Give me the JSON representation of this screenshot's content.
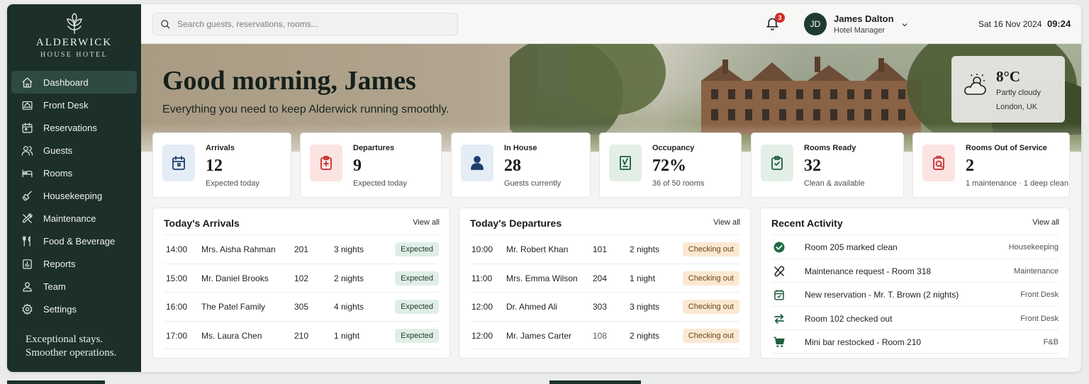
{
  "brand": {
    "name": "ALDERWICK",
    "sub": "HOUSE HOTEL",
    "tagline_1": "Exceptional stays.",
    "tagline_2": "Smoother operations."
  },
  "nav": [
    {
      "label": "Dashboard",
      "icon": "home-icon",
      "active": true
    },
    {
      "label": "Front Desk",
      "icon": "bell-desk-icon"
    },
    {
      "label": "Reservations",
      "icon": "calendar-icon"
    },
    {
      "label": "Guests",
      "icon": "users-icon"
    },
    {
      "label": "Rooms",
      "icon": "bed-icon"
    },
    {
      "label": "Housekeeping",
      "icon": "broom-icon"
    },
    {
      "label": "Maintenance",
      "icon": "tools-icon"
    },
    {
      "label": "Food & Beverage",
      "icon": "cutlery-icon"
    },
    {
      "label": "Reports",
      "icon": "chart-icon"
    },
    {
      "label": "Team",
      "icon": "team-icon"
    },
    {
      "label": "Settings",
      "icon": "gear-icon"
    }
  ],
  "topbar": {
    "search_placeholder": "Search guests, reservations, rooms...",
    "notifications": "3",
    "avatar": "JD",
    "user_name": "James Dalton",
    "user_role": "Hotel Manager",
    "date": "Sat 16 Nov 2024",
    "time": "09:24"
  },
  "hero": {
    "greeting": "Good morning, James",
    "subtitle": "Everything you need to keep Alderwick running smoothly.",
    "weather": {
      "temp": "8°C",
      "condition": "Partly cloudy",
      "location": "London, UK"
    }
  },
  "stats": [
    {
      "title": "Arrivals",
      "value": "12",
      "sub": "Expected today",
      "icon": "calendar-icon",
      "bg": "#e4ecf5",
      "fg": "#1d3f6e"
    },
    {
      "title": "Departures",
      "value": "9",
      "sub": "Expected today",
      "icon": "clipboard-icon",
      "bg": "#fbe3e1",
      "fg": "#c62d2d"
    },
    {
      "title": "In House",
      "value": "28",
      "sub": "Guests currently",
      "icon": "person-icon",
      "bg": "#e4ecf5",
      "fg": "#1d3f6e"
    },
    {
      "title": "Occupancy",
      "value": "72%",
      "sub": "36 of 50 rooms",
      "icon": "door-icon",
      "bg": "#e3eee7",
      "fg": "#1f5e3c"
    },
    {
      "title": "Rooms Ready",
      "value": "32",
      "sub": "Clean & available",
      "icon": "checklist-icon",
      "bg": "#e3eee7",
      "fg": "#1f5e3c"
    },
    {
      "title": "Rooms Out of Service",
      "value": "2",
      "sub": "1 maintenance · 1 deep clean",
      "icon": "warning-icon",
      "bg": "#fbe3e1",
      "fg": "#c62d2d"
    }
  ],
  "arrivals": {
    "title": "Today's Arrivals",
    "view_all": "View all",
    "rows": [
      {
        "time": "14:00",
        "guest": "Mrs. Aisha Rahman",
        "room": "201",
        "nights": "3 nights",
        "status": "Expected"
      },
      {
        "time": "15:00",
        "guest": "Mr. Daniel Brooks",
        "room": "102",
        "nights": "2 nights",
        "status": "Expected"
      },
      {
        "time": "16:00",
        "guest": "The Patel Family",
        "room": "305",
        "nights": "4 nights",
        "status": "Expected"
      },
      {
        "time": "17:00",
        "guest": "Ms. Laura Chen",
        "room": "210",
        "nights": "1 night",
        "status": "Expected"
      }
    ]
  },
  "departures": {
    "title": "Today's Departures",
    "view_all": "View all",
    "rows": [
      {
        "time": "10:00",
        "guest": "Mr. Robert Khan",
        "room": "101",
        "nights": "2 nights",
        "status": "Checking out"
      },
      {
        "time": "11:00",
        "guest": "Mrs. Emma Wilson",
        "room": "204",
        "nights": "1 night",
        "status": "Checking out"
      },
      {
        "time": "12:00",
        "guest": "Dr. Ahmed Ali",
        "room": "303",
        "nights": "3 nights",
        "status": "Checking out"
      },
      {
        "time": "12:00",
        "guest": "Mr. James Carter",
        "room": "108",
        "nights": "2 nights",
        "status": "Checking out"
      }
    ]
  },
  "activity": {
    "title": "Recent Activity",
    "view_all": "View all",
    "rows": [
      {
        "text": "Room 205 marked clean",
        "dept": "Housekeeping",
        "icon": "check-circle-icon",
        "color": "#1f6b45"
      },
      {
        "text": "Maintenance request - Room 318",
        "dept": "Maintenance",
        "icon": "tools-icon",
        "color": "#1f2522"
      },
      {
        "text": "New reservation - Mr. T. Brown (2 nights)",
        "dept": "Front Desk",
        "icon": "calendar-icon",
        "color": "#1f5e3c"
      },
      {
        "text": "Room 102 checked out",
        "dept": "Front Desk",
        "icon": "swap-arrows-icon",
        "color": "#1f5e3c"
      },
      {
        "text": "Mini bar restocked - Room 210",
        "dept": "F&B",
        "icon": "cart-icon",
        "color": "#1f5e3c"
      }
    ]
  }
}
